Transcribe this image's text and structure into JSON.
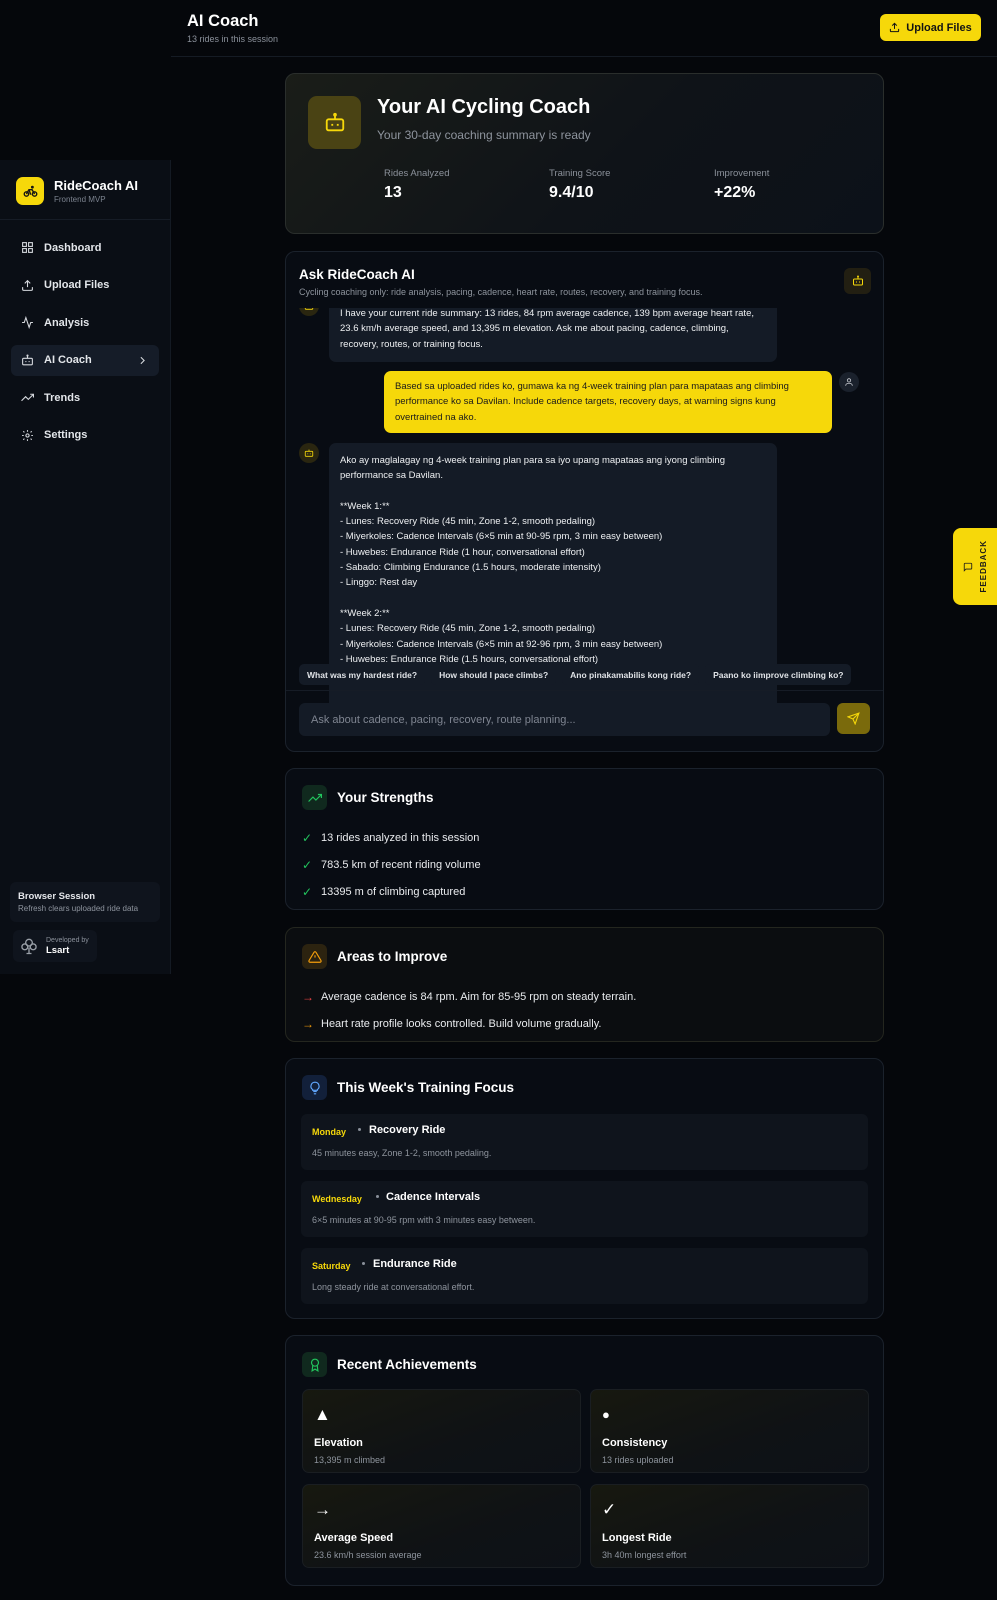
{
  "header": {
    "title": "AI Coach",
    "subtitle": "13 rides in this session",
    "upload_label": "Upload Files"
  },
  "sidebar": {
    "brand_title": "RideCoach AI",
    "brand_sub": "Frontend MVP",
    "items": [
      {
        "label": "Dashboard",
        "icon": "grid-icon"
      },
      {
        "label": "Upload Files",
        "icon": "upload-icon"
      },
      {
        "label": "Analysis",
        "icon": "activity-icon"
      },
      {
        "label": "AI Coach",
        "icon": "bot-icon",
        "active": true
      },
      {
        "label": "Trends",
        "icon": "trending-up-icon"
      },
      {
        "label": "Settings",
        "icon": "gear-icon"
      }
    ],
    "session_title": "Browser Session",
    "session_sub": "Refresh clears uploaded ride data",
    "dev_label": "Developed by",
    "dev_name": "Lsart"
  },
  "hero": {
    "title": "Your AI Cycling Coach",
    "subtitle": "Your 30-day coaching summary is ready",
    "stats": [
      {
        "label": "Rides Analyzed",
        "value": "13"
      },
      {
        "label": "Training Score",
        "value": "9.4/10"
      },
      {
        "label": "Improvement",
        "value": "+22%"
      }
    ]
  },
  "chat": {
    "title": "Ask RideCoach AI",
    "subtitle": "Cycling coaching only: ride analysis, pacing, cadence, heart rate, routes, recovery, and training focus.",
    "messages": [
      {
        "role": "bot",
        "text": "I have your current ride summary: 13 rides, 84 rpm average cadence, 139 bpm average heart rate,\n23.6 km/h average speed, and 13,395 m elevation. Ask me about pacing, cadence, climbing,\nrecovery, routes, or training focus."
      },
      {
        "role": "user",
        "text": "Based sa uploaded rides ko, gumawa ka ng 4-week training plan para mapataas ang climbing\nperformance ko sa Davilan. Include cadence targets, recovery days, at warning signs kung\novertrained na ako."
      },
      {
        "role": "bot",
        "text": "Ako ay maglalagay ng 4-week training plan para sa iyo upang mapataas ang iyong climbing\nperformance sa Davilan.\n\n**Week 1:**\n- Lunes: Recovery Ride (45 min, Zone 1-2, smooth pedaling)\n- Miyerkoles: Cadence Intervals (6×5 min at 90-95 rpm, 3 min easy between)\n- Huwebes: Endurance Ride (1 hour, conversational effort)\n- Sabado: Climbing Endurance (1.5 hours, moderate intensity)\n- Linggo: Rest day\n\n**Week 2:**\n- Lunes: Recovery Ride (45 min, Zone 1-2, smooth pedaling)\n- Miyerkoles: Cadence Intervals (6×5 min at 92-96 rpm, 3 min easy between)\n- Huwebes: Endurance Ride (1.5 hours, conversational effort)"
      }
    ],
    "suggestions": [
      "What was my hardest ride?",
      "How should I pace climbs?",
      "Ano pinakamabilis kong ride?",
      "Paano ko iimprove climbing ko?"
    ],
    "input_placeholder": "Ask about cadence, pacing, recovery, route planning..."
  },
  "strengths": {
    "title": "Your Strengths",
    "items": [
      "13 rides analyzed in this session",
      "783.5 km of recent riding volume",
      "13395 m of climbing captured"
    ]
  },
  "improve": {
    "title": "Areas to Improve",
    "items": [
      "Average cadence is 84 rpm. Aim for 85-95 rpm on steady terrain.",
      "Heart rate profile looks controlled. Build volume gradually."
    ]
  },
  "focus": {
    "title": "This Week's Training Focus",
    "items": [
      {
        "day": "Monday",
        "name": "Recovery Ride",
        "desc": "45 minutes easy, Zone 1-2, smooth pedaling."
      },
      {
        "day": "Wednesday",
        "name": "Cadence Intervals",
        "desc": "6×5 minutes at 90-95 rpm with 3 minutes easy between."
      },
      {
        "day": "Saturday",
        "name": "Endurance Ride",
        "desc": "Long steady ride at conversational effort."
      }
    ]
  },
  "achievements": {
    "title": "Recent Achievements",
    "items": [
      {
        "icon": "▲",
        "title": "Elevation",
        "sub": "13,395 m climbed"
      },
      {
        "icon": "●",
        "title": "Consistency",
        "sub": "13 rides uploaded"
      },
      {
        "icon": "→",
        "title": "Average Speed",
        "sub": "23.6 km/h session average"
      },
      {
        "icon": "✓",
        "title": "Longest Ride",
        "sub": "3h 40m longest effort"
      }
    ]
  },
  "feedback_label": "FEEDBACK",
  "colors": {
    "accent": "#f6d80a",
    "success": "#22c55e",
    "warning_red": "#ef4444",
    "warning_orange": "#f59e0b"
  }
}
